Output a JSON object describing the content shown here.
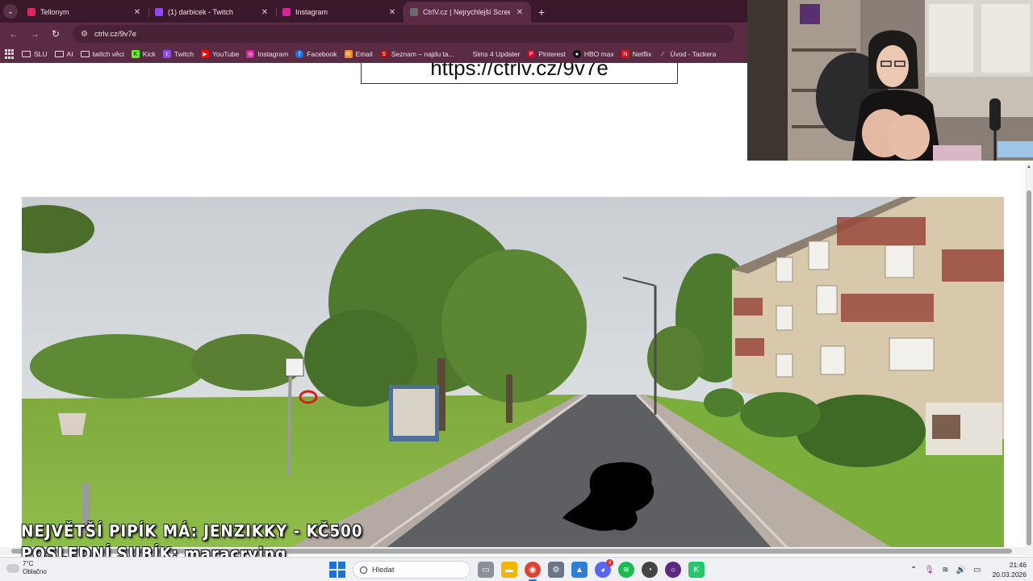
{
  "tabs": [
    {
      "label": "Tellonym",
      "favicon_color": "#e0245e",
      "active": false
    },
    {
      "label": "(1) darbicek - Twitch",
      "favicon_color": "#9146ff",
      "active": false
    },
    {
      "label": "Instagram",
      "favicon_color": "#d6249f",
      "active": false
    },
    {
      "label": "CtrlV.cz | Nejrychlejší ScreenSh",
      "favicon_color": "#6b6b6b",
      "active": true
    }
  ],
  "address": {
    "url": "ctrlv.cz/9v7e"
  },
  "bookmarks": [
    {
      "label": "SLU",
      "type": "folder"
    },
    {
      "label": "AI",
      "type": "folder"
    },
    {
      "label": "twitch věci",
      "type": "folder"
    },
    {
      "label": "Kick",
      "icon": "kick-icon",
      "color": "#53fc18"
    },
    {
      "label": "Twitch",
      "icon": "twitch-icon",
      "color": "#9146ff"
    },
    {
      "label": "YouTube",
      "icon": "youtube-icon",
      "color": "#ff0000"
    },
    {
      "label": "Instagram",
      "icon": "instagram-icon",
      "color": "#d6249f"
    },
    {
      "label": "Facebook",
      "icon": "facebook-icon",
      "color": "#1877f2"
    },
    {
      "label": "Email",
      "icon": "email-icon",
      "color": "#f28b24"
    },
    {
      "label": "Seznam – najdu ta...",
      "icon": "seznam-icon",
      "color": "#cc0000"
    },
    {
      "label": "Sims 4 Updater",
      "icon": "sims-icon",
      "color": "#3c8c3c"
    },
    {
      "label": "Pinterest",
      "icon": "pinterest-icon",
      "color": "#e60023"
    },
    {
      "label": "HBO max",
      "icon": "hbo-icon",
      "color": "#111111"
    },
    {
      "label": "Netflix",
      "icon": "netflix-icon",
      "color": "#e50914"
    },
    {
      "label": "Úvod - Tackera",
      "icon": "tackera-icon",
      "color": "#444444"
    }
  ],
  "page": {
    "shared_link": "https://ctrlv.cz/9v7e"
  },
  "overlay": {
    "line1": "NEJVĚTŠÍ PIPÍK MÁ: JENZIKKY - KČ500",
    "line2": "POSLEDNÍ SUBÍK: maracrying"
  },
  "taskbar": {
    "weather_temp": "7°C",
    "weather_desc": "Oblačno",
    "search_placeholder": "Hledat",
    "apps": [
      {
        "name": "task-view-icon",
        "color": "#7a7f88"
      },
      {
        "name": "file-explorer-icon",
        "color": "#f4b400"
      },
      {
        "name": "chrome-icon",
        "color": "#db4437",
        "active": true
      },
      {
        "name": "settings-icon",
        "color": "#6a7688"
      },
      {
        "name": "photos-icon",
        "color": "#2f7fd6"
      },
      {
        "name": "discord-icon",
        "color": "#5865f2",
        "badge": "4"
      },
      {
        "name": "spotify-icon",
        "color": "#1db954"
      },
      {
        "name": "obs-icon",
        "color": "#444444"
      },
      {
        "name": "assistant-icon",
        "color": "#5b2b83"
      },
      {
        "name": "kick-app-icon",
        "color": "#28c76f"
      }
    ],
    "time": "21:46",
    "date": "20.03.2026"
  }
}
